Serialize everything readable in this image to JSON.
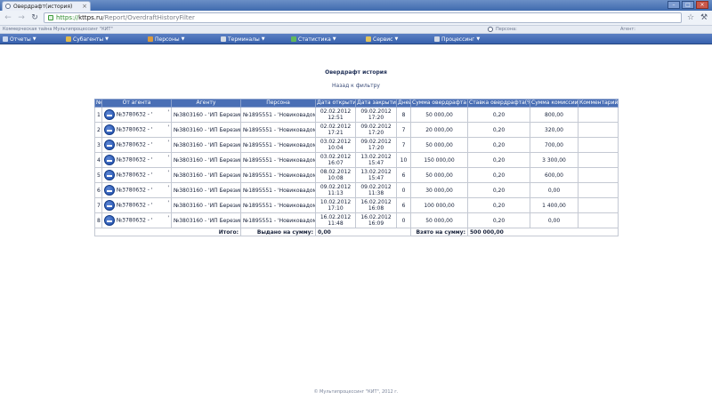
{
  "browser": {
    "tab_title": "Овердрафт(история)",
    "tab_close": "×",
    "url_scheme": "https://",
    "url_host": "kttps.ru",
    "url_path": "/Report/OverdraftHistoryFilter",
    "back": "←",
    "forward": "→",
    "reload": "↻",
    "star": "☆",
    "wrench": "⚒",
    "min": "–",
    "max": "□",
    "close": "×"
  },
  "appstrip": {
    "org": "Коммерческая тайна Мультипроцессинг \"КИТ\"",
    "persona_label": "Персона:",
    "agent_label": "Агент:"
  },
  "menu": [
    {
      "label": "Отчеты",
      "color": "#c9d6ee"
    },
    {
      "label": "Субагенты",
      "color": "#e0b94a"
    },
    {
      "label": "Персоны",
      "color": "#d99a3e"
    },
    {
      "label": "Терминалы",
      "color": "#d4dbe6"
    },
    {
      "label": "Статистика",
      "color": "#61b85c"
    },
    {
      "label": "Сервис",
      "color": "#e0c25c"
    },
    {
      "label": "Процессинг",
      "color": "#d0d8e6"
    }
  ],
  "page": {
    "title": "Овердрафт история",
    "back_link": "Назад к фильтру"
  },
  "table": {
    "headers": [
      "№",
      "От агента",
      "Агенту",
      "Персона",
      "Дата открытия",
      "Дата закрытия",
      "Дней",
      "Сумма овердрафта",
      "Ставка овердрафта(%)",
      "Сумма комиссии",
      "Комментарий"
    ],
    "rows": [
      {
        "n": "1",
        "from": "№3780632 - '",
        "tail": "'",
        "to": "№3803160 - 'ИП Березин'",
        "persona": "№1895551 - 'Новиковадом'",
        "open": [
          "02.02.2012",
          "12:51"
        ],
        "close": [
          "09.02.2012",
          "17:20"
        ],
        "days": "8",
        "sum": "50 000,00",
        "rate": "0,20",
        "fee": "800,00",
        "comment": ""
      },
      {
        "n": "2",
        "from": "№3780632 - '",
        "tail": "'",
        "to": "№3803160 - 'ИП Березин'",
        "persona": "№1895551 - 'Новиковадом'",
        "open": [
          "02.02.2012",
          "17:21"
        ],
        "close": [
          "09.02.2012",
          "17:20"
        ],
        "days": "7",
        "sum": "20 000,00",
        "rate": "0,20",
        "fee": "320,00",
        "comment": ""
      },
      {
        "n": "3",
        "from": "№3780632 - '",
        "tail": "'",
        "to": "№3803160 - 'ИП Березин'",
        "persona": "№1895551 - 'Новиковадом'",
        "open": [
          "03.02.2012",
          "10:04"
        ],
        "close": [
          "09.02.2012",
          "17:20"
        ],
        "days": "7",
        "sum": "50 000,00",
        "rate": "0,20",
        "fee": "700,00",
        "comment": ""
      },
      {
        "n": "4",
        "from": "№3780632 - '",
        "tail": "'",
        "to": "№3803160 - 'ИП Березин'",
        "persona": "№1895551 - 'Новиковадом'",
        "open": [
          "03.02.2012",
          "16:07"
        ],
        "close": [
          "13.02.2012",
          "15:47"
        ],
        "days": "10",
        "sum": "150 000,00",
        "rate": "0,20",
        "fee": "3 300,00",
        "comment": ""
      },
      {
        "n": "5",
        "from": "№3780632 - '",
        "tail": "'",
        "to": "№3803160 - 'ИП Березин'",
        "persona": "№1895551 - 'Новиковадом'",
        "open": [
          "08.02.2012",
          "10:08"
        ],
        "close": [
          "13.02.2012",
          "15:47"
        ],
        "days": "6",
        "sum": "50 000,00",
        "rate": "0,20",
        "fee": "600,00",
        "comment": ""
      },
      {
        "n": "6",
        "from": "№3780632 - '",
        "tail": "'",
        "to": "№3803160 - 'ИП Березин'",
        "persona": "№1895551 - 'Новиковадом'",
        "open": [
          "09.02.2012",
          "11:13"
        ],
        "close": [
          "09.02.2012",
          "11:38"
        ],
        "days": "0",
        "sum": "30 000,00",
        "rate": "0,20",
        "fee": "0,00",
        "comment": ""
      },
      {
        "n": "7",
        "from": "№3780632 - '",
        "tail": "'",
        "to": "№3803160 - 'ИП Березин'",
        "persona": "№1895551 - 'Новиковадом'",
        "open": [
          "10.02.2012",
          "17:10"
        ],
        "close": [
          "16.02.2012",
          "16:08"
        ],
        "days": "6",
        "sum": "100 000,00",
        "rate": "0,20",
        "fee": "1 400,00",
        "comment": ""
      },
      {
        "n": "8",
        "from": "№3780632 - '",
        "tail": "'",
        "to": "№3803160 - 'ИП Березин'",
        "persona": "№1895551 - 'Новиковадом'",
        "open": [
          "16.02.2012",
          "11:48"
        ],
        "close": [
          "16.02.2012",
          "16:09"
        ],
        "days": "0",
        "sum": "50 000,00",
        "rate": "0,20",
        "fee": "0,00",
        "comment": ""
      }
    ],
    "totals": {
      "label": "Итого:",
      "issued_label": "Выдано на сумму:",
      "issued_value": "0,00",
      "taken_label": "Взято на сумму:",
      "taken_value": "500 000,00"
    }
  },
  "footer": "© Мультипроцессинг \"КИТ\", 2012 г."
}
